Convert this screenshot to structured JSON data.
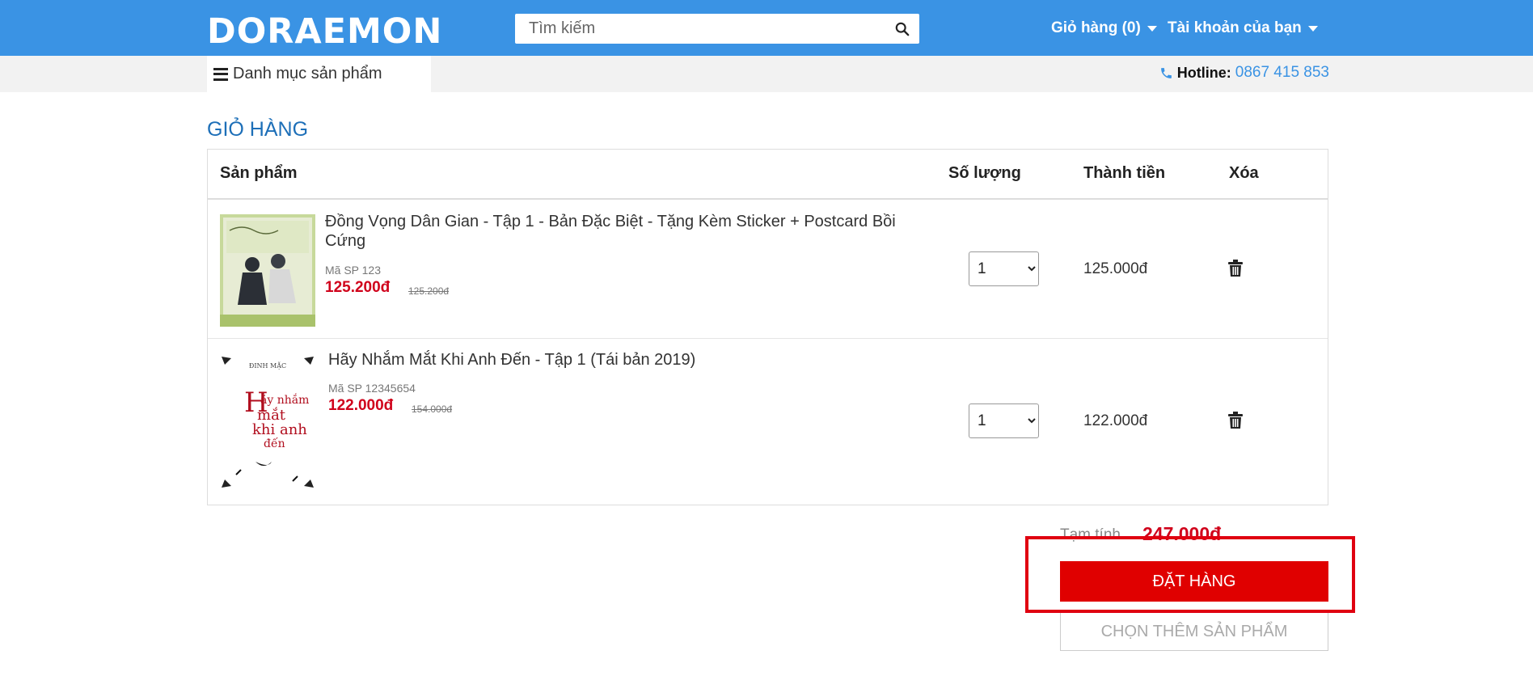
{
  "header": {
    "logo": "DORAEMON",
    "search_placeholder": "Tìm kiếm",
    "cart_label": "Giỏ hàng (0)",
    "account_label": "Tài khoản của bạn"
  },
  "subheader": {
    "category_label": "Danh mục sản phẩm",
    "hotline_label": "Hotline:",
    "hotline_number": "0867 415 853"
  },
  "cart": {
    "title": "GIỎ HÀNG",
    "columns": {
      "product": "Sản phẩm",
      "quantity": "Số lượng",
      "total": "Thành tiền",
      "delete": "Xóa"
    },
    "items": [
      {
        "name": "Đồng Vọng Dân Gian - Tập 1 - Bản Đặc Biệt - Tặng Kèm Sticker + Postcard Bồi Cứng",
        "code": "Mã SP 123",
        "price": "125.200đ",
        "old_price": "125.200đ",
        "quantity": "1",
        "total": "125.000đ"
      },
      {
        "name": "Hãy Nhắm Mắt Khi Anh Đến - Tập 1 (Tái bản 2019)",
        "code": "Mã SP 12345654",
        "price": "122.000đ",
        "old_price": "154.000đ",
        "quantity": "1",
        "total": "122.000đ"
      }
    ],
    "subtotal_label": "Tạm tính",
    "subtotal_value": "247.000đ",
    "order_button": "ĐẶT HÀNG",
    "continue_button": "CHỌN THÊM SẢN PHẨM"
  },
  "colors": {
    "brand": "#3a93e4",
    "price": "#d0021b",
    "order_button": "#e00000"
  }
}
